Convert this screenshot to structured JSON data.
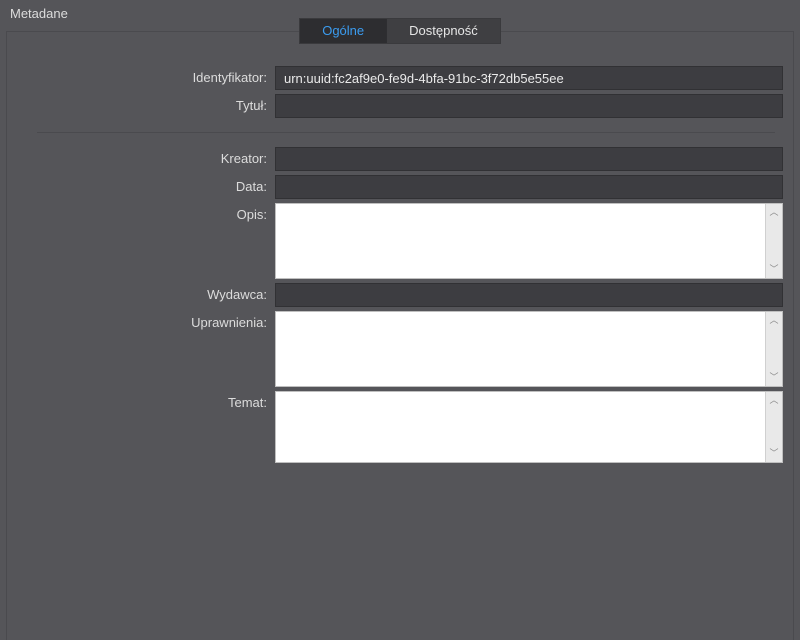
{
  "panel": {
    "title": "Metadane"
  },
  "tabs": {
    "general": "Ogólne",
    "accessibility": "Dostępność"
  },
  "labels": {
    "identifier": "Identyfikator:",
    "title": "Tytuł:",
    "creator": "Kreator:",
    "date": "Data:",
    "description": "Opis:",
    "publisher": "Wydawca:",
    "rights": "Uprawnienia:",
    "subject": "Temat:"
  },
  "values": {
    "identifier": "urn:uuid:fc2af9e0-fe9d-4bfa-91bc-3f72db5e55ee",
    "title": "",
    "creator": "",
    "date": "",
    "description": "",
    "publisher": "",
    "rights": "",
    "subject": ""
  }
}
